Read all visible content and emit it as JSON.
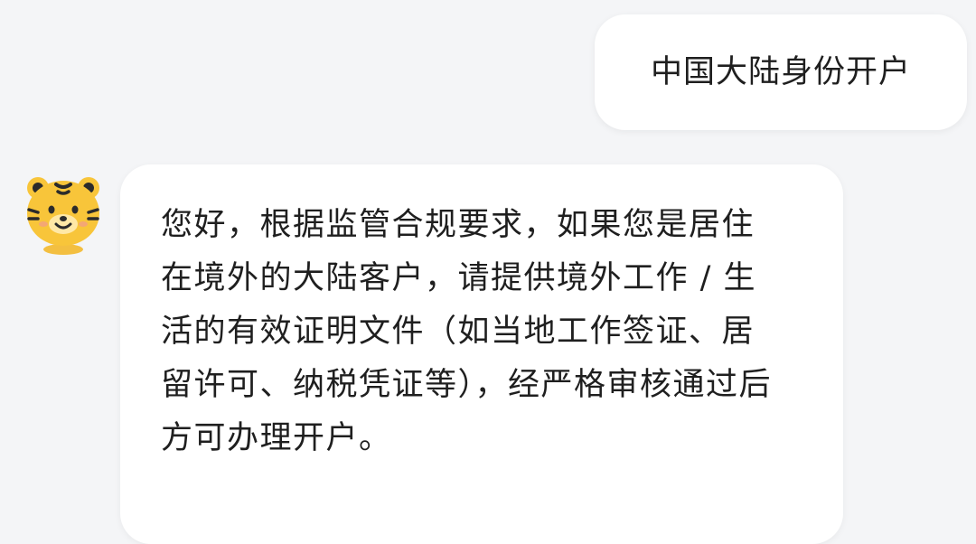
{
  "conversation": {
    "user_message": {
      "text": "中国大陆身份开户"
    },
    "assistant_message": {
      "avatar_icon": "tiger-mascot-icon",
      "text": "您好，根据监管合规要求，如果您是居住在境外的大陆客户，请提供境外工作 / 生活的有效证明文件（如当地工作签证、居留许可、纳税凭证等），经严格审核通过后方可办理开户。"
    }
  },
  "colors": {
    "background": "#f4f5f7",
    "bubble": "#ffffff",
    "text": "#1f1f1f",
    "avatar_yellow": "#f8c53a",
    "avatar_dark": "#2b2b2b"
  }
}
